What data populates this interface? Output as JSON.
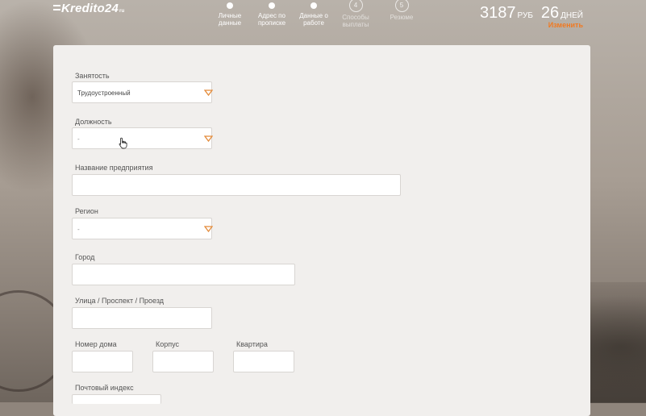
{
  "brand": {
    "name": "Kredito24",
    "suffix": "ru"
  },
  "steps": [
    {
      "marker": "",
      "label_1": "Личные",
      "label_2": "данные",
      "state": "done"
    },
    {
      "marker": "",
      "label_1": "Адрес по",
      "label_2": "прописке",
      "state": "done"
    },
    {
      "marker": "",
      "label_1": "Данные о",
      "label_2": "работе",
      "state": "current"
    },
    {
      "marker": "4",
      "label_1": "Способы",
      "label_2": "выплаты",
      "state": "upcoming"
    },
    {
      "marker": "5",
      "label_1": "Резюме",
      "label_2": "",
      "state": "upcoming"
    }
  ],
  "summary": {
    "amount": "3187",
    "currency": "РУБ",
    "days": "26",
    "days_unit": "ДНЕЙ",
    "change_label": "Изменить"
  },
  "form": {
    "employment": {
      "label": "Занятость",
      "value": "Трудоустроенный"
    },
    "position": {
      "label": "Должность",
      "value": "-"
    },
    "company": {
      "label": "Название предприятия",
      "value": ""
    },
    "region": {
      "label": "Регион",
      "value": "-"
    },
    "city": {
      "label": "Город",
      "value": ""
    },
    "street": {
      "label": "Улица / Проспект / Проезд",
      "value": ""
    },
    "house": {
      "label": "Номер дома",
      "value": ""
    },
    "building": {
      "label": "Корпус",
      "value": ""
    },
    "apartment": {
      "label": "Квартира",
      "value": ""
    },
    "postal": {
      "label": "Почтовый индекс",
      "value": ""
    }
  },
  "colors": {
    "accent": "#f07a22",
    "panel": "#f1efed"
  }
}
